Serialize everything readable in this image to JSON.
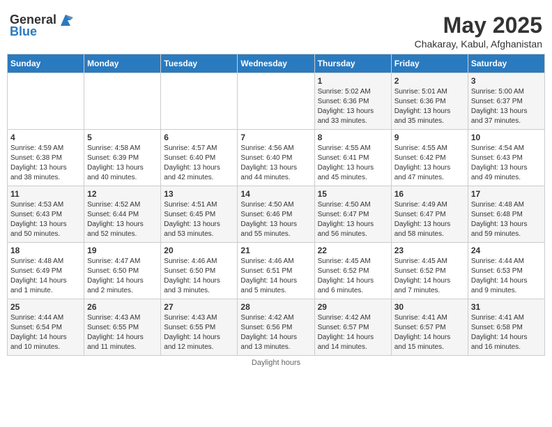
{
  "header": {
    "logo_general": "General",
    "logo_blue": "Blue",
    "main_title": "May 2025",
    "sub_title": "Chakaray, Kabul, Afghanistan"
  },
  "days_of_week": [
    "Sunday",
    "Monday",
    "Tuesday",
    "Wednesday",
    "Thursday",
    "Friday",
    "Saturday"
  ],
  "weeks": [
    [
      {
        "day": "",
        "info": ""
      },
      {
        "day": "",
        "info": ""
      },
      {
        "day": "",
        "info": ""
      },
      {
        "day": "",
        "info": ""
      },
      {
        "day": "1",
        "info": "Sunrise: 5:02 AM\nSunset: 6:36 PM\nDaylight: 13 hours\nand 33 minutes."
      },
      {
        "day": "2",
        "info": "Sunrise: 5:01 AM\nSunset: 6:36 PM\nDaylight: 13 hours\nand 35 minutes."
      },
      {
        "day": "3",
        "info": "Sunrise: 5:00 AM\nSunset: 6:37 PM\nDaylight: 13 hours\nand 37 minutes."
      }
    ],
    [
      {
        "day": "4",
        "info": "Sunrise: 4:59 AM\nSunset: 6:38 PM\nDaylight: 13 hours\nand 38 minutes."
      },
      {
        "day": "5",
        "info": "Sunrise: 4:58 AM\nSunset: 6:39 PM\nDaylight: 13 hours\nand 40 minutes."
      },
      {
        "day": "6",
        "info": "Sunrise: 4:57 AM\nSunset: 6:40 PM\nDaylight: 13 hours\nand 42 minutes."
      },
      {
        "day": "7",
        "info": "Sunrise: 4:56 AM\nSunset: 6:40 PM\nDaylight: 13 hours\nand 44 minutes."
      },
      {
        "day": "8",
        "info": "Sunrise: 4:55 AM\nSunset: 6:41 PM\nDaylight: 13 hours\nand 45 minutes."
      },
      {
        "day": "9",
        "info": "Sunrise: 4:55 AM\nSunset: 6:42 PM\nDaylight: 13 hours\nand 47 minutes."
      },
      {
        "day": "10",
        "info": "Sunrise: 4:54 AM\nSunset: 6:43 PM\nDaylight: 13 hours\nand 49 minutes."
      }
    ],
    [
      {
        "day": "11",
        "info": "Sunrise: 4:53 AM\nSunset: 6:43 PM\nDaylight: 13 hours\nand 50 minutes."
      },
      {
        "day": "12",
        "info": "Sunrise: 4:52 AM\nSunset: 6:44 PM\nDaylight: 13 hours\nand 52 minutes."
      },
      {
        "day": "13",
        "info": "Sunrise: 4:51 AM\nSunset: 6:45 PM\nDaylight: 13 hours\nand 53 minutes."
      },
      {
        "day": "14",
        "info": "Sunrise: 4:50 AM\nSunset: 6:46 PM\nDaylight: 13 hours\nand 55 minutes."
      },
      {
        "day": "15",
        "info": "Sunrise: 4:50 AM\nSunset: 6:47 PM\nDaylight: 13 hours\nand 56 minutes."
      },
      {
        "day": "16",
        "info": "Sunrise: 4:49 AM\nSunset: 6:47 PM\nDaylight: 13 hours\nand 58 minutes."
      },
      {
        "day": "17",
        "info": "Sunrise: 4:48 AM\nSunset: 6:48 PM\nDaylight: 13 hours\nand 59 minutes."
      }
    ],
    [
      {
        "day": "18",
        "info": "Sunrise: 4:48 AM\nSunset: 6:49 PM\nDaylight: 14 hours\nand 1 minute."
      },
      {
        "day": "19",
        "info": "Sunrise: 4:47 AM\nSunset: 6:50 PM\nDaylight: 14 hours\nand 2 minutes."
      },
      {
        "day": "20",
        "info": "Sunrise: 4:46 AM\nSunset: 6:50 PM\nDaylight: 14 hours\nand 3 minutes."
      },
      {
        "day": "21",
        "info": "Sunrise: 4:46 AM\nSunset: 6:51 PM\nDaylight: 14 hours\nand 5 minutes."
      },
      {
        "day": "22",
        "info": "Sunrise: 4:45 AM\nSunset: 6:52 PM\nDaylight: 14 hours\nand 6 minutes."
      },
      {
        "day": "23",
        "info": "Sunrise: 4:45 AM\nSunset: 6:52 PM\nDaylight: 14 hours\nand 7 minutes."
      },
      {
        "day": "24",
        "info": "Sunrise: 4:44 AM\nSunset: 6:53 PM\nDaylight: 14 hours\nand 9 minutes."
      }
    ],
    [
      {
        "day": "25",
        "info": "Sunrise: 4:44 AM\nSunset: 6:54 PM\nDaylight: 14 hours\nand 10 minutes."
      },
      {
        "day": "26",
        "info": "Sunrise: 4:43 AM\nSunset: 6:55 PM\nDaylight: 14 hours\nand 11 minutes."
      },
      {
        "day": "27",
        "info": "Sunrise: 4:43 AM\nSunset: 6:55 PM\nDaylight: 14 hours\nand 12 minutes."
      },
      {
        "day": "28",
        "info": "Sunrise: 4:42 AM\nSunset: 6:56 PM\nDaylight: 14 hours\nand 13 minutes."
      },
      {
        "day": "29",
        "info": "Sunrise: 4:42 AM\nSunset: 6:57 PM\nDaylight: 14 hours\nand 14 minutes."
      },
      {
        "day": "30",
        "info": "Sunrise: 4:41 AM\nSunset: 6:57 PM\nDaylight: 14 hours\nand 15 minutes."
      },
      {
        "day": "31",
        "info": "Sunrise: 4:41 AM\nSunset: 6:58 PM\nDaylight: 14 hours\nand 16 minutes."
      }
    ]
  ],
  "footer": {
    "text": "Daylight hours"
  }
}
